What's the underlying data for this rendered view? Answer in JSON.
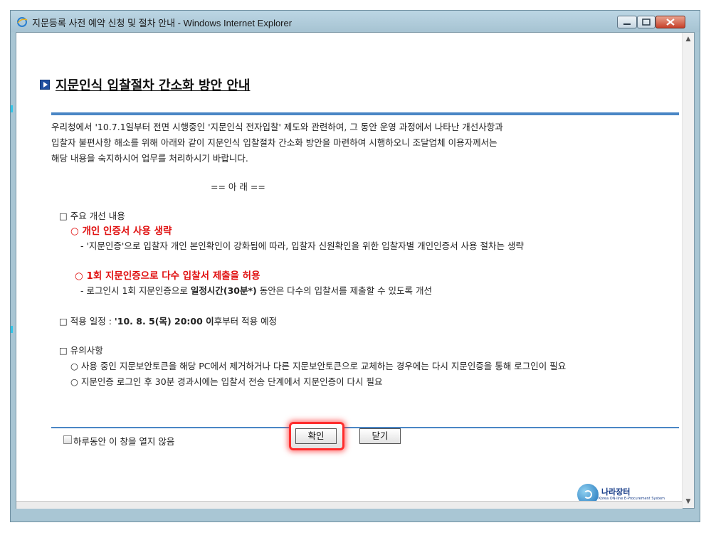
{
  "window": {
    "title": "지문등록 사전 예약 신청 및 절차 안내 - Windows Internet Explorer"
  },
  "heading": "지문인식 입찰절차 간소화 방안 안내",
  "intro": [
    "우리청에서 '10.7.1일부터 전면 시행중인 '지문인식 전자입찰' 제도와 관련하여, 그 동안 운영 과정에서 나타난 개선사항과",
    "입찰자 불편사항 해소를 위해 아래와 같이 지문인식 입찰절차 간소화 방안을 마련하여 시행하오니 조달업체 이용자께서는",
    "해당 내용을 숙지하시어 업무를 처리하시기 바랍니다."
  ],
  "center_note": "== 아  래 ==",
  "section1": {
    "title": "□ 주요 개선 내용",
    "item1_title": "○ 개인 인증서 사용 생략",
    "item1_desc": "- '지문인증'으로 입찰자 개인 본인확인이 강화됨에 따라, 입찰자 신원확인을 위한 입찰자별 개인인증서 사용 절차는 생략",
    "item2_title": "○ 1회 지문인증으로 다수 입찰서 제출을 허용",
    "item2_desc_pre": "- 로그인시 1회 지문인증으로 ",
    "item2_desc_bold": "일정시간(30분*)",
    "item2_desc_post": " 동안은 다수의 입찰서를 제출할 수 있도록 개선"
  },
  "section2": {
    "pre": "□ 적용 일정 : ",
    "bold": "'10. 8. 5(목) 20:00 이",
    "post": "후부터 적용 예정"
  },
  "section3": {
    "title": "□ 유의사항",
    "note1": "○ 사용 중인 지문보안토큰을 해당 PC에서 제거하거나 다른 지문보안토큰으로 교체하는 경우에는 다시 지문인증을 통해 로그인이 필요",
    "note2": "○ 지문인증 로그인 후 30분 경과시에는 입찰서 전송 단계에서 지문인증이 다시 필요"
  },
  "footer": {
    "checkbox_label": "하루동안 이 창을 열지 않음",
    "ok_label": "확인",
    "close_label": "닫기"
  },
  "logo": {
    "name": "나라장터",
    "sub": "Korea ON-line E-Procurement System"
  },
  "colors": {
    "accent": "#4a86c5",
    "highlight": "#e01010",
    "titlebar": "#a9c6d4"
  }
}
